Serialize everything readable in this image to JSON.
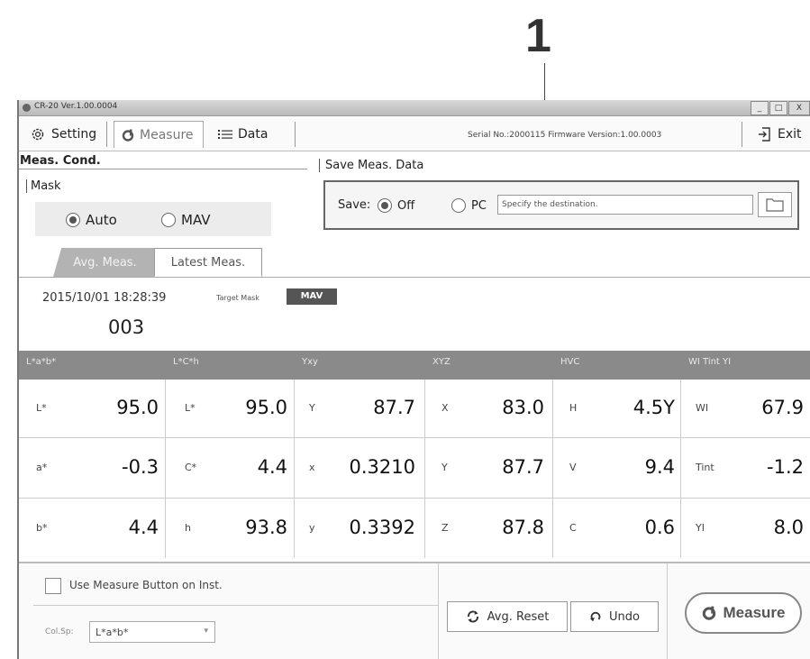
{
  "callout": {
    "number": "1"
  },
  "window": {
    "title": "CR-20 Ver.1.00.0004",
    "controls": {
      "minimize": "_",
      "maximize": "□",
      "close": "X"
    }
  },
  "toolbar": {
    "setting_label": "Setting",
    "measure_label": "Measure",
    "data_label": "Data",
    "serial_info": "Serial No.:2000115   Firmware Version:1.00.0003",
    "exit_label": "Exit"
  },
  "meas_cond": {
    "title": "Meas. Cond.",
    "mask_label": "Mask",
    "options": [
      "Auto",
      "MAV"
    ],
    "selected": "Auto"
  },
  "save": {
    "title": "Save Meas. Data",
    "label": "Save:",
    "options": [
      "Off",
      "PC"
    ],
    "selected": "Off",
    "destination_placeholder": "Specify the destination."
  },
  "tabs": [
    {
      "label": "Avg. Meas.",
      "active": false
    },
    {
      "label": "Latest Meas.",
      "active": true
    }
  ],
  "measurement": {
    "datetime": "2015/10/01 18:28:39",
    "target_mask_label": "Target Mask",
    "target_mask_value": "MAV",
    "count": "003"
  },
  "groups": [
    {
      "header": "L*a*b*",
      "rows": [
        {
          "label": "L*",
          "value": "95.0"
        },
        {
          "label": "a*",
          "value": "-0.3"
        },
        {
          "label": "b*",
          "value": "4.4"
        }
      ]
    },
    {
      "header": "L*C*h",
      "rows": [
        {
          "label": "L*",
          "value": "95.0"
        },
        {
          "label": "C*",
          "value": "4.4"
        },
        {
          "label": "h",
          "value": "93.8"
        }
      ]
    },
    {
      "header": "Yxy",
      "rows": [
        {
          "label": "Y",
          "value": "87.7"
        },
        {
          "label": "x",
          "value": "0.3210"
        },
        {
          "label": "y",
          "value": "0.3392"
        }
      ]
    },
    {
      "header": "XYZ",
      "rows": [
        {
          "label": "X",
          "value": "83.0"
        },
        {
          "label": "Y",
          "value": "87.7"
        },
        {
          "label": "Z",
          "value": "87.8"
        }
      ]
    },
    {
      "header": "HVC",
      "rows": [
        {
          "label": "H",
          "value": "4.5Y"
        },
        {
          "label": "V",
          "value": "9.4"
        },
        {
          "label": "C",
          "value": "0.6"
        }
      ]
    },
    {
      "header": "WI Tint YI",
      "rows": [
        {
          "label": "WI",
          "value": "67.9"
        },
        {
          "label": "Tint",
          "value": "-1.2"
        },
        {
          "label": "YI",
          "value": "8.0"
        }
      ]
    }
  ],
  "bottom": {
    "use_button_label": "Use Measure Button on Inst.",
    "colsp_label": "Col.Sp:",
    "colsp_value": "L*a*b*",
    "avg_reset_label": "Avg. Reset",
    "undo_label": "Undo",
    "measure_label": "Measure"
  },
  "icons": {
    "setting": "gear-icon",
    "measure": "measure-logo-icon",
    "data": "list-icon",
    "exit": "exit-icon",
    "folder": "folder-icon",
    "avg_reset": "refresh-icon",
    "undo": "undo-icon"
  }
}
